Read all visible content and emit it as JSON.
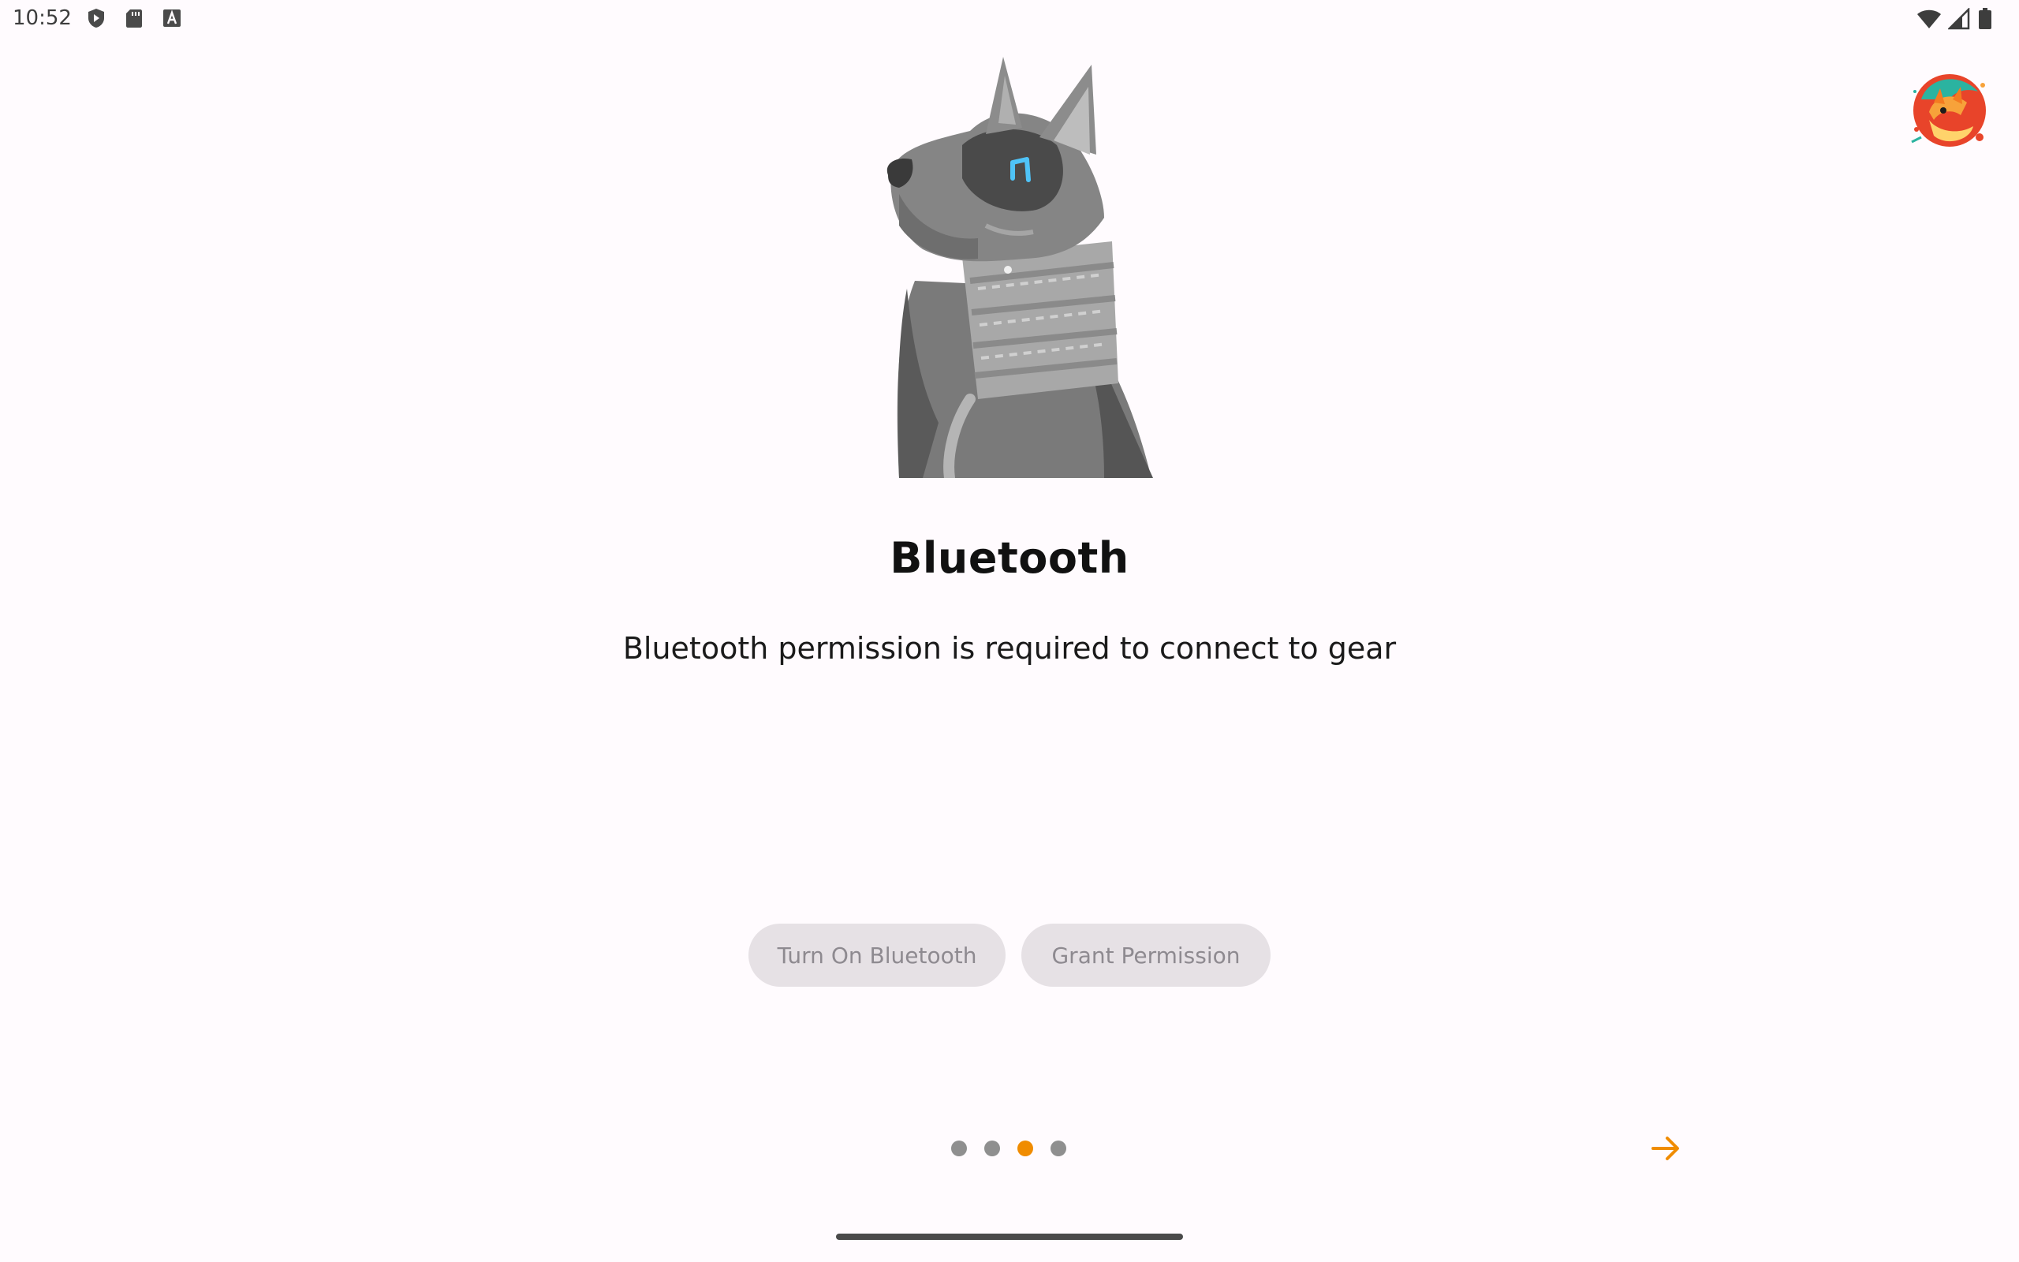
{
  "status_bar": {
    "time": "10:52",
    "left_icons": [
      "play-protect-icon",
      "sd-card-icon",
      "keyboard-a-icon"
    ],
    "right_icons": [
      "wifi-icon",
      "signal-icon",
      "battery-icon"
    ]
  },
  "onboarding": {
    "title": "Bluetooth",
    "description": "Bluetooth permission is required to connect to gear",
    "buttons": {
      "turn_on_bluetooth": "Turn On Bluetooth",
      "grant_permission": "Grant Permission"
    },
    "pager": {
      "total_pages": 4,
      "current_page": 3
    }
  },
  "colors": {
    "background": "#fffbfe",
    "accent": "#f08c00",
    "dot_inactive": "#8f8f8f",
    "button_bg": "#e6e1e5",
    "button_text": "#8e8a90",
    "eye_glow": "#4fc3f7"
  }
}
